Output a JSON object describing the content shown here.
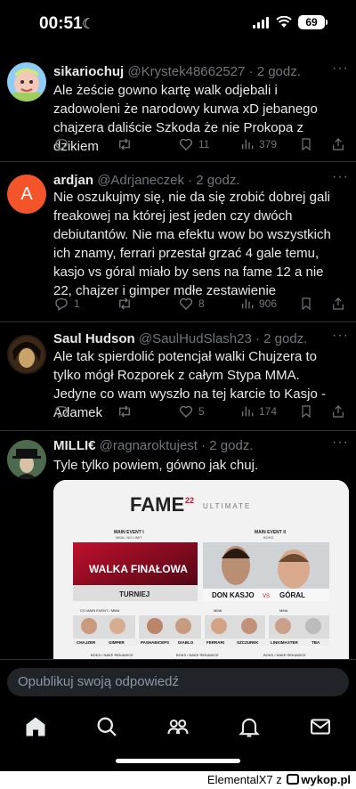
{
  "status": {
    "time": "00:51",
    "battery": "69"
  },
  "tweets": [
    {
      "name": "sikariochuj",
      "handle": "@Krystek48662527",
      "time": " · 2 godz.",
      "text": "Ale żeście gowno kartę walk odjebali i zadowoleni że narodowy kurwa xD jebanego chajzera daliście Szkoda że nie Prokopa z dzikiem",
      "replies": "",
      "reposts": "",
      "likes": "11",
      "views": "379"
    },
    {
      "name": "ardjan",
      "handle": "@Adrjaneczek",
      "time": " · 2 godz.",
      "avatar_letter": "A",
      "text": "Nie oszukujmy się, nie da się zrobić dobrej gali freakowej na której jest jeden czy dwóch debiutantów. Nie ma efektu wow bo wszystkich ich znamy, ferrari przestał grzać 4 gale temu, kasjo vs góral miało by sens na fame 12 a nie 22, chajzer i gimper mdłe zestawienie",
      "replies": "1",
      "reposts": "",
      "likes": "8",
      "views": "906"
    },
    {
      "name": "Saul Hudson",
      "handle": "@SaulHudSlash23",
      "time": " · 2 godz.",
      "text": "Ale tak spierdolić potencjał walki Chujzera to tylko mógł Rozporek z całym Stypa MMA. Jedyne co wam wyszło na tej karcie to Kasjo - Adamek",
      "replies": "",
      "reposts": "",
      "likes": "5",
      "views": "174"
    },
    {
      "name": "MILLI€",
      "handle": "@ragnaroktujest",
      "time": " · 2 godz.",
      "text": "Tyle tylko powiem, gówno jak chuj."
    }
  ],
  "poster": {
    "logo": "FAME",
    "logo_num": "22",
    "subtitle": "ULTIMATE",
    "me1_title": "MAIN EVENT I",
    "me1_sub": "MMA / NO LIMIT",
    "me2_title": "MAIN EVENT II",
    "me2_sub": "BOKS",
    "final_text": "WALKA FINAŁOWA",
    "tournament": "TURNIEJ",
    "kasjo": "DON KASJO",
    "vs": "VS",
    "goral": "GÓRAL",
    "co_label": "CO MAIN EVENT / MMA",
    "mma_label": "MMA",
    "mma2_label": "MMA",
    "names": [
      "CHAJZER",
      "GIMPER",
      "PASHABICEPS",
      "DIABLO",
      "FERRARI",
      "SZCZUREK",
      "LINKIMASTER",
      "TBA"
    ],
    "boks1": "BOKS / NAKE REKAWICE",
    "boks2": "BOKS / NAKE REKAWICE",
    "boks3": "BOKS / NAKE REKAWICE"
  },
  "reply_placeholder": "Opublikuj swoją odpowiedź",
  "watermark": "ElementalX7 z",
  "watermark_site": "wykop.pl"
}
